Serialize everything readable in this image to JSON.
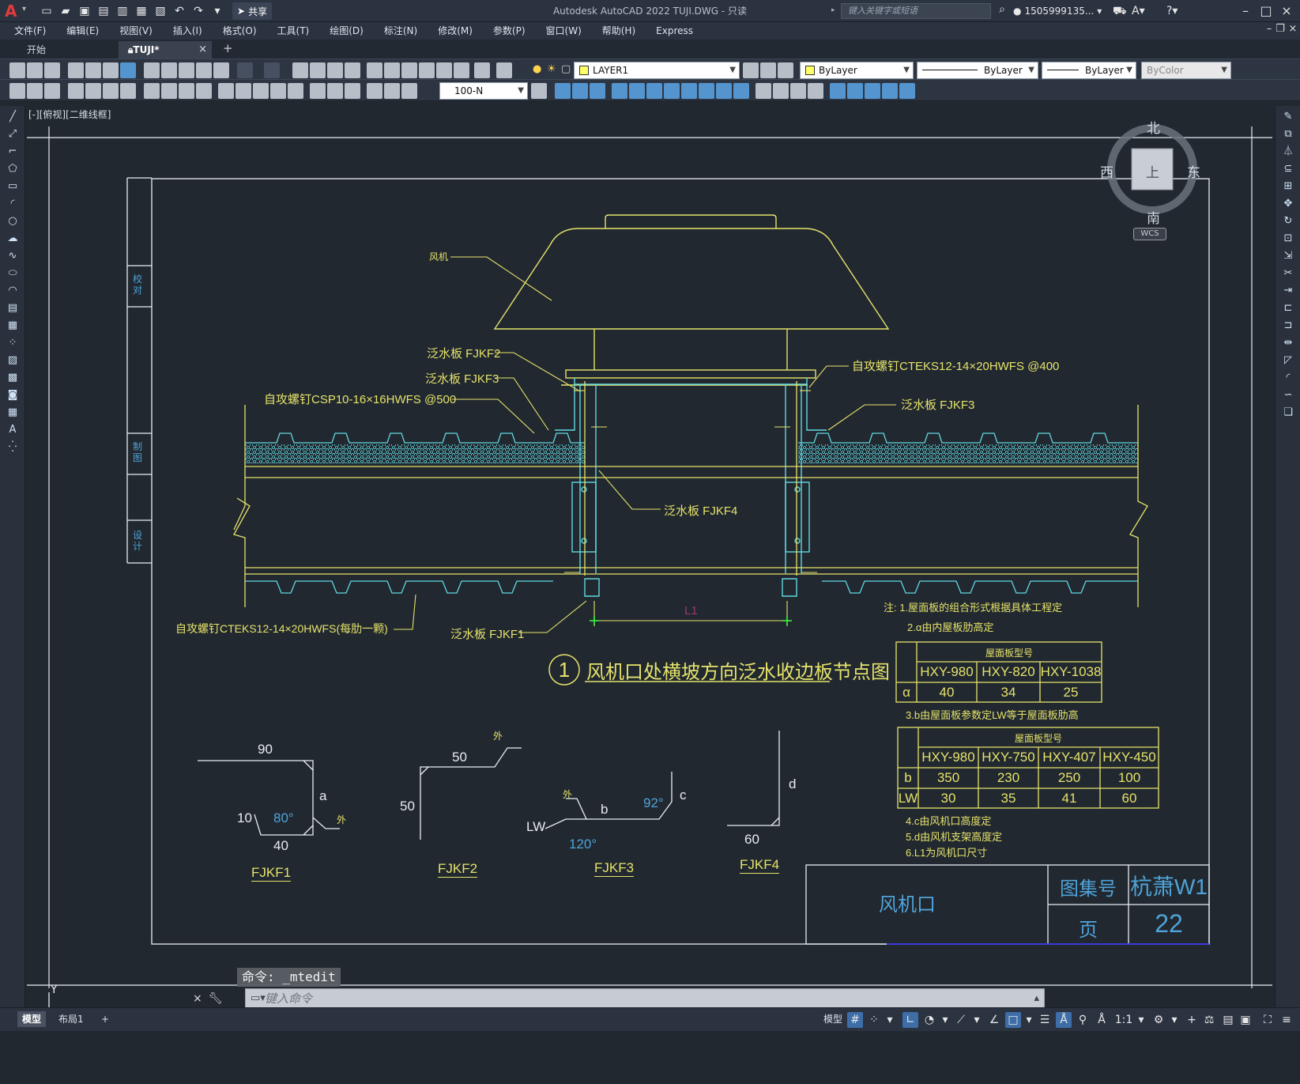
{
  "app": {
    "title": "Autodesk AutoCAD 2022    TUJI.DWG - 只读",
    "search_placeholder": "键入关键字或短语",
    "user": "1505999135...",
    "share_label": "共享"
  },
  "menu": [
    "文件(F)",
    "编辑(E)",
    "视图(V)",
    "插入(I)",
    "格式(O)",
    "工具(T)",
    "绘图(D)",
    "标注(N)",
    "修改(M)",
    "参数(P)",
    "窗口(W)",
    "帮助(H)",
    "Express"
  ],
  "tabs": {
    "start": "开始",
    "active": "TUJI*"
  },
  "properties": {
    "layer": "LAYER1",
    "color": "ByLayer",
    "linetype": "ByLayer",
    "lineweight": "ByLayer",
    "plotstyle": "ByColor",
    "dimstyle": "100-N"
  },
  "viewport_label": "[-][俯视][二维线框]",
  "viewcube": {
    "north": "北",
    "south": "南",
    "east": "东",
    "west": "西",
    "face": "上",
    "wcs": "WCS"
  },
  "drawing": {
    "title_circle": "1",
    "title": "风机口处横坡方向泛水收边板节点图",
    "labels": {
      "fan": "风机",
      "fjkf2_callout": "泛水板 FJKF2",
      "fjkf3_callout_left": "泛水板 FJKF3",
      "screw_csp": "自攻螺钉CSP10-16×16HWFS @500",
      "screw_cteks_top": "自攻螺钉CTEKS12-14×20HWFS @400",
      "fjkf3_callout_right": "泛水板 FJKF3",
      "fjkf4_callout": "泛水板 FJKF4",
      "screw_cteks_bottom": "自攻螺钉CTEKS12-14×20HWFS(每肋一颗)",
      "fjkf1_callout": "泛水板 FJKF1",
      "l1": "L1"
    },
    "notes": {
      "n1": "注:  1.屋面板的组合形式根据具体工程定",
      "n2": "2.α由内屋板肋高定",
      "n3": "3.b由屋面板参数定LW等于屋面板肋高",
      "n4": "4.c由风机口高度定",
      "n5": "5.d由风机支架高度定",
      "n6": "6.L1为风机口尺寸"
    },
    "table1": {
      "header": "屋面板型号",
      "cols": [
        "HXY-980",
        "HXY-820",
        "HXY-1038"
      ],
      "row_label": "α",
      "values": [
        "40",
        "34",
        "25"
      ]
    },
    "table2": {
      "header": "屋面板型号",
      "cols": [
        "HXY-980",
        "HXY-750",
        "HXY-407",
        "HXY-450"
      ],
      "rows": [
        {
          "label": "b",
          "values": [
            "350",
            "230",
            "250",
            "100"
          ]
        },
        {
          "label": "LW",
          "values": [
            "30",
            "35",
            "41",
            "60"
          ]
        }
      ]
    },
    "details": {
      "fjkf1": {
        "name": "FJKF1",
        "top": "90",
        "left": "10",
        "angle": "80°",
        "bottom": "40",
        "side": "a",
        "out": "外"
      },
      "fjkf2": {
        "name": "FJKF2",
        "top": "50",
        "left": "50",
        "out": "外"
      },
      "fjkf3": {
        "name": "FJKF3",
        "b": "b",
        "c": "c",
        "lw": "LW",
        "angle1": "92°",
        "angle2": "120°",
        "out": "外"
      },
      "fjkf4": {
        "name": "FJKF4",
        "d": "d",
        "bottom": "60"
      }
    },
    "title_block": {
      "name": "风机口",
      "atlas_label": "图集号",
      "atlas_value": "杭萧W1",
      "page_label": "页",
      "page_value": "22"
    },
    "side_strip": {
      "check": "校对",
      "draw": "制图",
      "design": "设计"
    }
  },
  "command": {
    "history": "命令: _mtedit",
    "placeholder": "键入命令"
  },
  "status": {
    "model_tab": "模型",
    "layout_tab": "布局1",
    "model_btn": "模型",
    "scale": "1:1"
  },
  "colors": {
    "yellow": "#e6e36a",
    "cyan": "#62d8e0",
    "blue_text": "#4fa3d9",
    "bg": "#212830"
  }
}
